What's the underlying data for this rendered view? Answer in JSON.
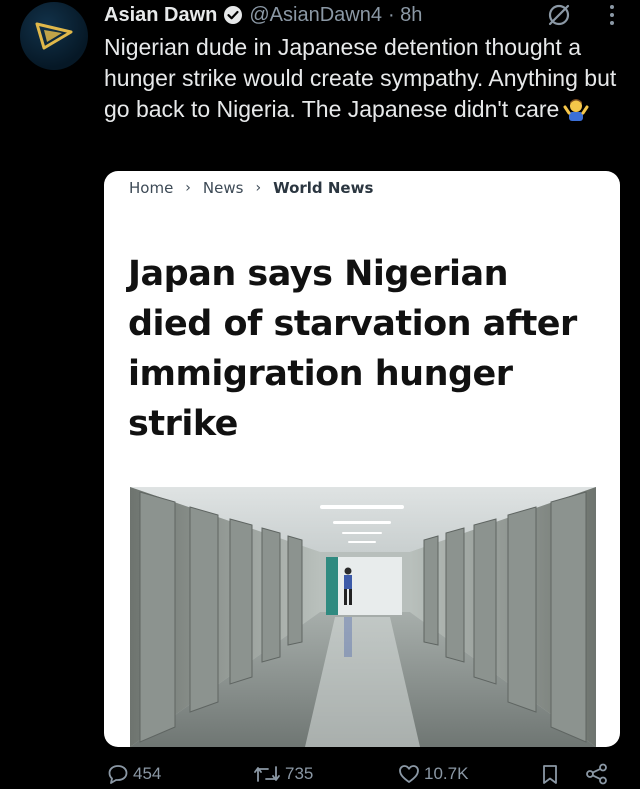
{
  "tweet": {
    "author_name": "Asian Dawn",
    "handle": "@AsianDawn4",
    "time": "· 8h",
    "text": "Nigerian dude in Japanese detention thought a hunger strike would create sympathy. Anything but go back to Nigeria. The Japanese didn't care",
    "emoji": "man-shrugging-emoji"
  },
  "card": {
    "breadcrumbs": [
      "Home",
      "News",
      "World News"
    ],
    "headline": "Japan says Nigerian died of starvation after immigration hunger strike",
    "image_description_icon": "detention-corridor-photo"
  },
  "actions": {
    "replies": "454",
    "reposts": "735",
    "likes": "10.7K"
  },
  "colors": {
    "background": "#000000",
    "text": "#e7e9ea",
    "muted": "#8b98a5",
    "verified": "#1d9bf0",
    "avatar_logo": "#e0b84a"
  }
}
